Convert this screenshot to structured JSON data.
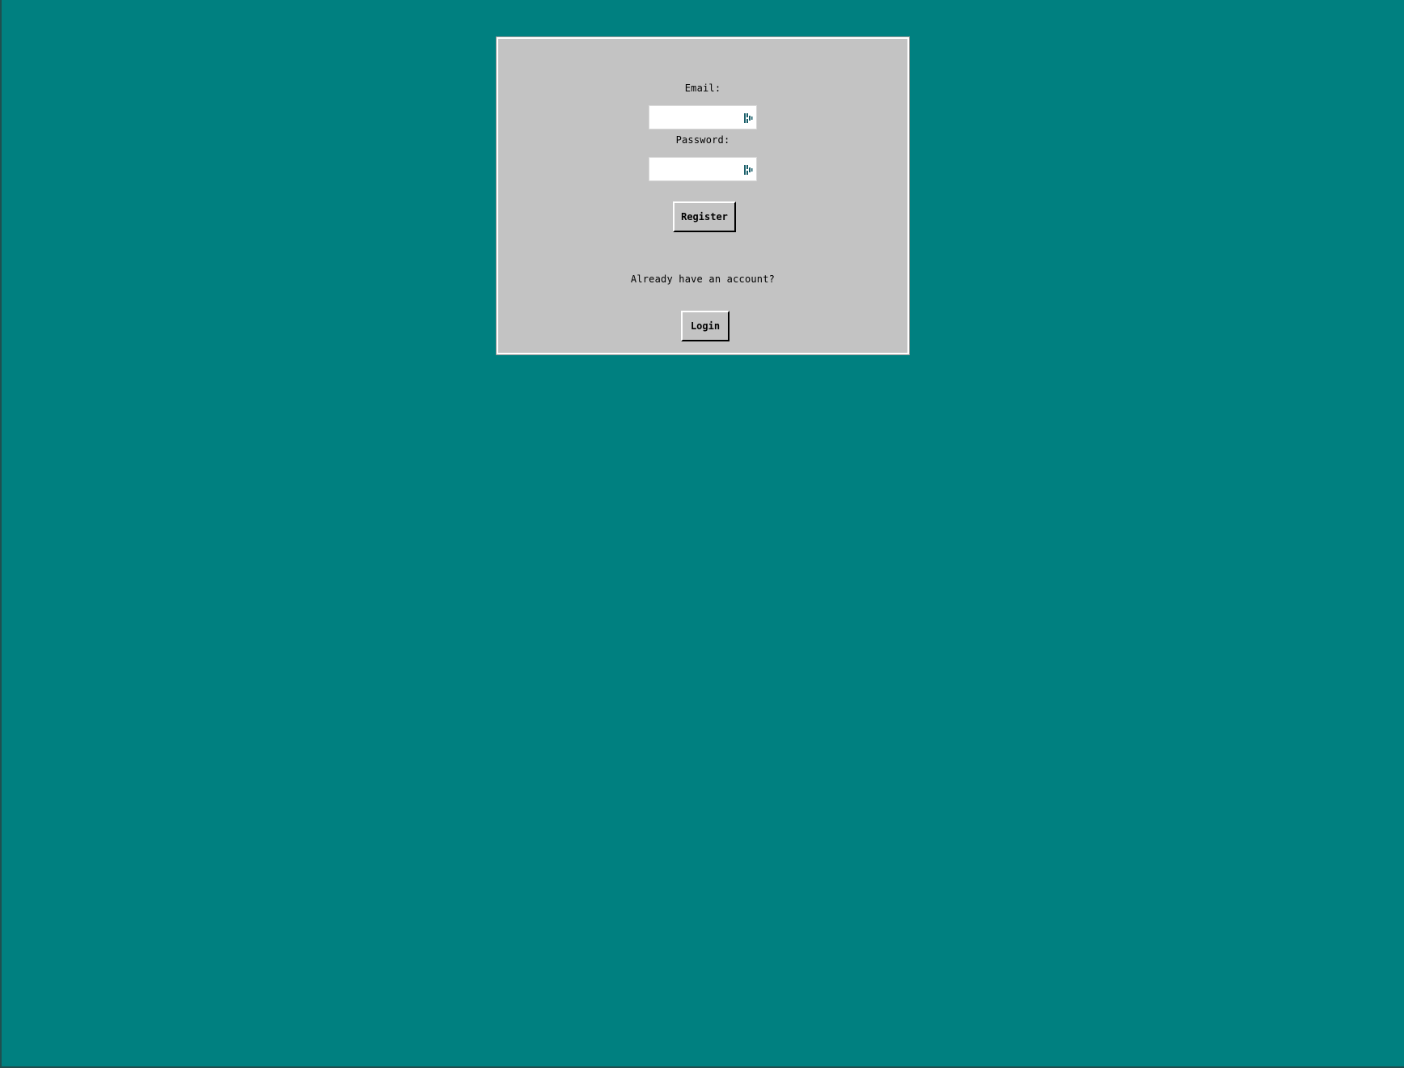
{
  "form": {
    "email_label": "Email:",
    "email_value": "",
    "password_label": "Password:",
    "password_value": "",
    "register_label": "Register",
    "prompt_text": "Already have an account?",
    "login_label": "Login"
  },
  "icons": {
    "field_icon": "password-manager-icon"
  },
  "colors": {
    "desktop_background": "#008080",
    "panel_background": "#c3c3c3",
    "icon_color": "#1a5f6a"
  }
}
